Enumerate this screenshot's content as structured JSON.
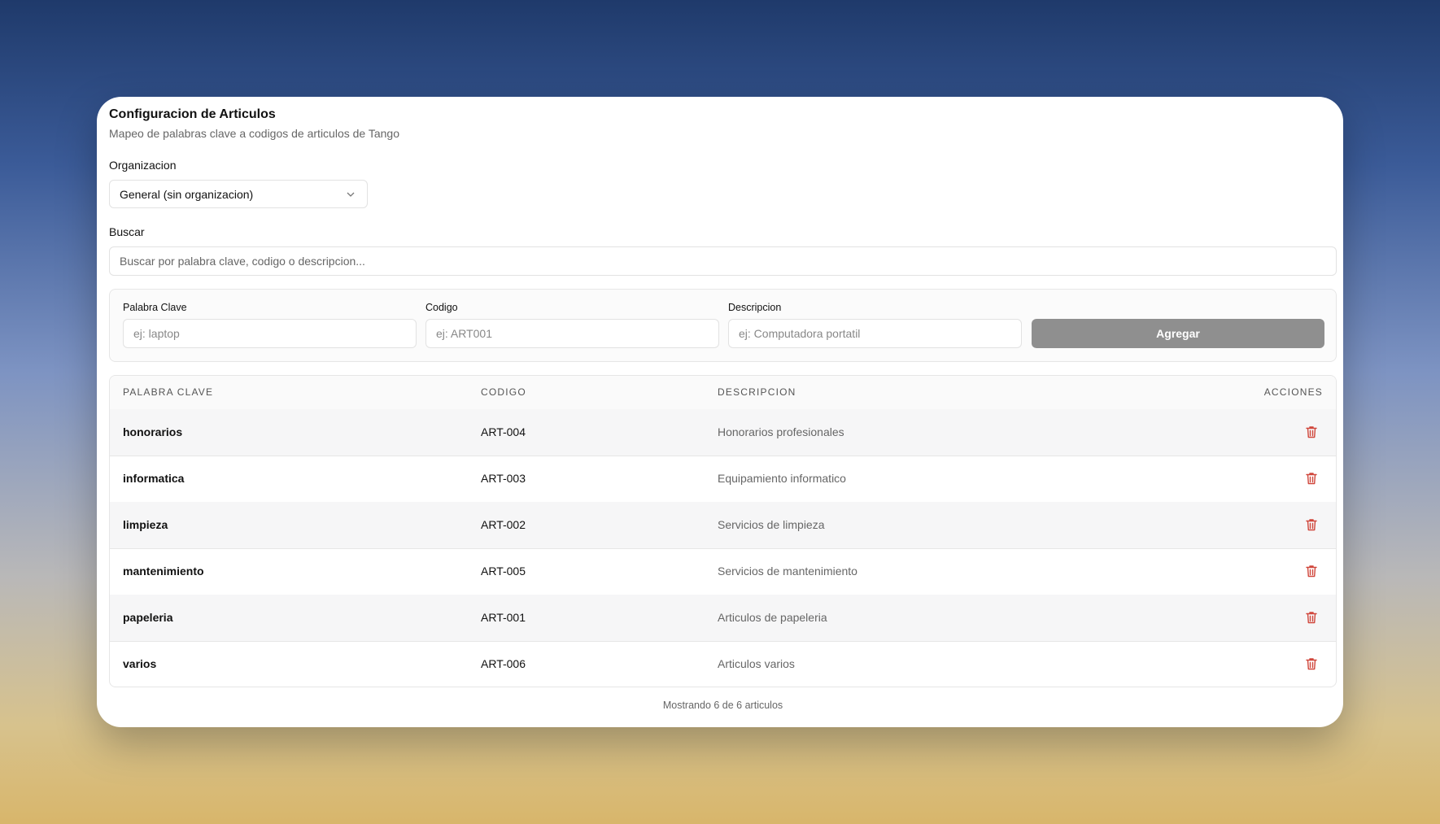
{
  "header": {
    "title": "Configuracion de Articulos",
    "subtitle": "Mapeo de palabras clave a codigos de articulos de Tango"
  },
  "organization": {
    "label": "Organizacion",
    "selected": "General (sin organizacion)"
  },
  "search": {
    "label": "Buscar",
    "placeholder": "Buscar por palabra clave, codigo o descripcion..."
  },
  "add_form": {
    "keyword_label": "Palabra Clave",
    "keyword_placeholder": "ej: laptop",
    "code_label": "Codigo",
    "code_placeholder": "ej: ART001",
    "description_label": "Descripcion",
    "description_placeholder": "ej: Computadora portatil",
    "add_button": "Agregar"
  },
  "table": {
    "columns": [
      "PALABRA CLAVE",
      "CODIGO",
      "DESCRIPCION",
      "ACCIONES"
    ],
    "rows": [
      {
        "keyword": "honorarios",
        "code": "ART-004",
        "description": "Honorarios profesionales"
      },
      {
        "keyword": "informatica",
        "code": "ART-003",
        "description": "Equipamiento informatico"
      },
      {
        "keyword": "limpieza",
        "code": "ART-002",
        "description": "Servicios de limpieza"
      },
      {
        "keyword": "mantenimiento",
        "code": "ART-005",
        "description": "Servicios de mantenimiento"
      },
      {
        "keyword": "papeleria",
        "code": "ART-001",
        "description": "Articulos de papeleria"
      },
      {
        "keyword": "varios",
        "code": "ART-006",
        "description": "Articulos varios"
      }
    ],
    "action_icon": "trash-icon"
  },
  "footer": {
    "summary": "Mostrando 6 de 6 articulos"
  },
  "colors": {
    "delete_icon": "#d0463b",
    "add_button_bg": "#8f8f8f"
  }
}
